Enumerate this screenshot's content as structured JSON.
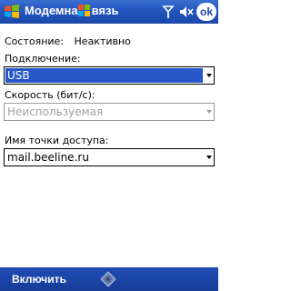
{
  "titlebar": {
    "title_left": "Модемна",
    "title_right": "вязь",
    "ok_label": "ok"
  },
  "status": {
    "label": "Состояние:",
    "value": "Неактивно"
  },
  "connection": {
    "label": "Подключение:",
    "selected": "USB"
  },
  "speed": {
    "label": "Скорость (бит/с):",
    "selected": "Неиспользуемая"
  },
  "apn": {
    "label": "Имя точки доступа:",
    "selected": "mail.beeline.ru"
  },
  "menubar": {
    "left_softkey": "Включить"
  },
  "icons": [
    "windows-start-icon",
    "windows-logo-icon",
    "signal-antenna-icon",
    "volume-icon",
    "keyboard-sip-icon"
  ],
  "colors": {
    "titlebar": "#2457c0",
    "selection": "#2658c8",
    "menubar": "#1f4db5"
  }
}
